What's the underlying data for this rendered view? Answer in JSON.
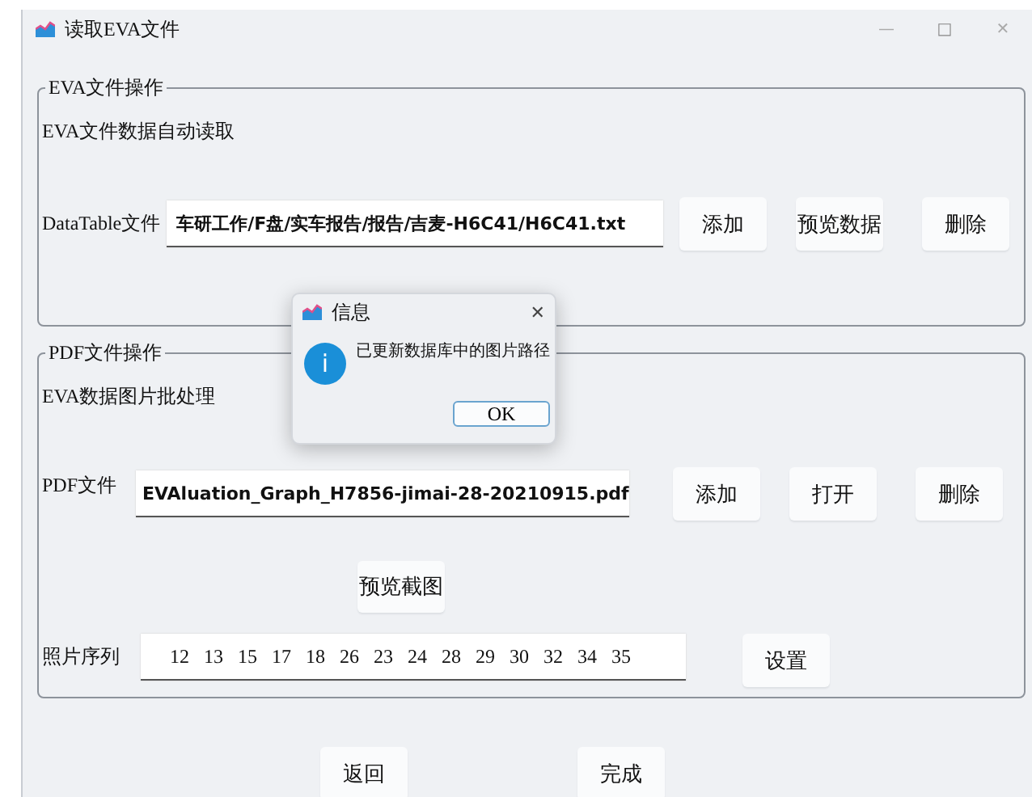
{
  "window": {
    "title": "读取EVA文件",
    "controls": [
      "—",
      "□",
      "✕"
    ]
  },
  "eva_group": {
    "legend": "EVA文件操作",
    "description": "EVA文件数据自动读取",
    "label": "DataTable文件",
    "field_value": "车研工作/F盘/实车报告/报告/吉麦-H6C41/H6C41.txt",
    "buttons": [
      "添加",
      "预览数据",
      "删除"
    ]
  },
  "pdf_group": {
    "legend": "PDF文件操作",
    "description": "EVA数据图片批处理",
    "label": "PDF文件",
    "field_value": "EVAluation_Graph_H7856-jimai-28-20210915.pdf",
    "buttons": [
      "添加",
      "打开",
      "删除"
    ],
    "preview_button": "预览截图",
    "sequence_label": "照片序列",
    "sequence_value": "12   13   15   17   18   26   23   24   28   29   30   32   34   35",
    "sequence_button": "设置"
  },
  "footer_buttons": [
    "返回",
    "完成"
  ],
  "dialog": {
    "title": "信息",
    "close": "✕",
    "icon_glyph": "i",
    "message": "已更新数据库中的图片路径",
    "button": "OK"
  }
}
